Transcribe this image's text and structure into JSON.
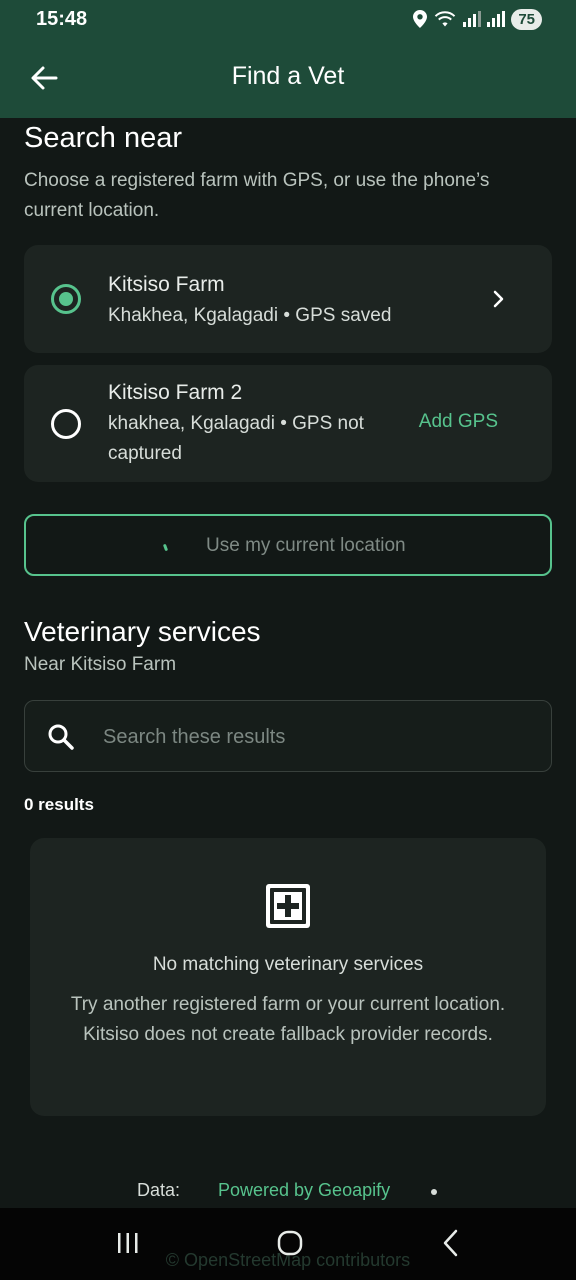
{
  "status": {
    "time": "15:48",
    "battery": "75"
  },
  "appbar": {
    "title": "Find a Vet"
  },
  "search_near": {
    "heading": "Search near",
    "description": "Choose a registered farm with GPS, or use the phone’s current location."
  },
  "farms": [
    {
      "name": "Kitsiso Farm",
      "detail": "Khakhea, Kgalagadi • GPS saved",
      "selected": true
    },
    {
      "name": "Kitsiso Farm 2",
      "detail": "khakhea, Kgalagadi • GPS not captured",
      "action": "Add GPS",
      "selected": false
    }
  ],
  "location_button": {
    "label": "Use my current location"
  },
  "services": {
    "heading": "Veterinary services",
    "subheading": "Near Kitsiso Farm",
    "search_placeholder": "Search these results",
    "count": "0 results"
  },
  "empty_state": {
    "title": "No matching veterinary services",
    "text": "Try another registered farm or your current location. Kitsiso does not create fallback provider records."
  },
  "footer": {
    "data_label": "Data:",
    "powered_by": "Powered by Geoapify",
    "attribution": "© OpenStreetMap contributors"
  },
  "colors": {
    "header": "#1e4b39",
    "accent": "#57c38d",
    "background": "#121816",
    "card": "#1d2421"
  }
}
